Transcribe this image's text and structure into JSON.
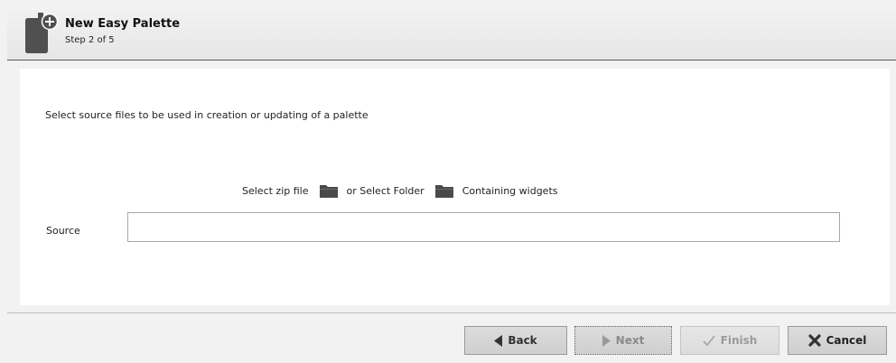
{
  "header": {
    "title": "New Easy Palette",
    "step": "Step 2 of 5"
  },
  "content": {
    "instructions": "Select source files to be used in creation or updating of a palette",
    "select_zip_label": "Select zip file",
    "select_folder_label": "or Select Folder",
    "containing_label": "Containing widgets",
    "source_label": "Source",
    "source_value": ""
  },
  "buttons": {
    "back": "Back",
    "next": "Next",
    "finish": "Finish",
    "cancel": "Cancel"
  },
  "icons": {
    "header": "palette-add-icon",
    "zip_folder": "folder-icon",
    "folder": "folder-icon",
    "back": "arrow-left-icon",
    "next": "arrow-right-icon",
    "finish": "checkmark-icon",
    "cancel": "close-x-icon"
  },
  "colors": {
    "header_bg": "#e8e8e8",
    "content_bg": "#ffffff",
    "button_bg": "#d4d4d4",
    "icon_dark": "#4a4a4a"
  }
}
